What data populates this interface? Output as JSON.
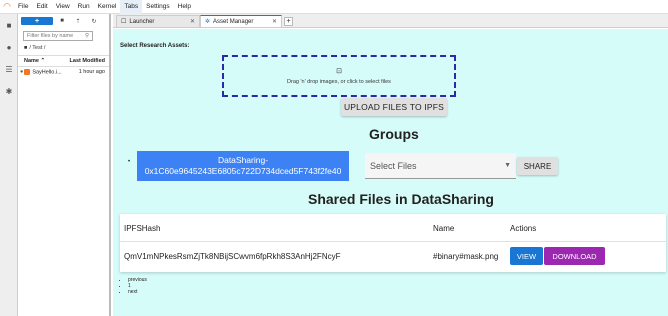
{
  "menubar": {
    "items": [
      "File",
      "Edit",
      "View",
      "Run",
      "Kernel",
      "Tabs",
      "Settings",
      "Help"
    ],
    "active_index": 5
  },
  "filebrowser": {
    "new_label": "+",
    "filter_placeholder": "Filter files by name",
    "breadcrumb": "/ Test /",
    "columns": {
      "name": "Name",
      "modified": "Last Modified"
    },
    "files": [
      {
        "name": "SayHello.i...",
        "modified": "1 hour ago",
        "running": true
      }
    ]
  },
  "tabs": [
    {
      "label": "Launcher",
      "active": false
    },
    {
      "label": "Asset Manager",
      "active": true
    }
  ],
  "main": {
    "select_label": "Select Research Assets:",
    "dropzone_text": "Drag 'n' drop images, or click to select files",
    "upload_label": "UPLOAD FILES TO IPFS",
    "groups_title": "Groups",
    "group": {
      "line1": "DataSharing-",
      "line2": "0x1C60e9645243E6805c722D734dced5F743f2fe40"
    },
    "select_files_placeholder": "Select Files",
    "share_label": "SHARE",
    "shared_title": "Shared Files in DataSharing",
    "table": {
      "headers": [
        "IPFSHash",
        "Name",
        "Actions"
      ],
      "rows": [
        {
          "hash": "QmV1mNPkesRsmZjTk8NBijSCwvm6fpRkh8S3AnHj2FNcyF",
          "name": "#binary#mask.png",
          "view": "VIEW",
          "download": "DOWNLOAD"
        }
      ]
    },
    "pagination": [
      "previous",
      "1",
      "next"
    ]
  },
  "colors": {
    "panel_bg": "#d6fcfa",
    "group_chip": "#3d82f5",
    "view_button": "#1976d2",
    "download_button": "#9c27b0",
    "dropzone_border": "#2a2aa8"
  }
}
